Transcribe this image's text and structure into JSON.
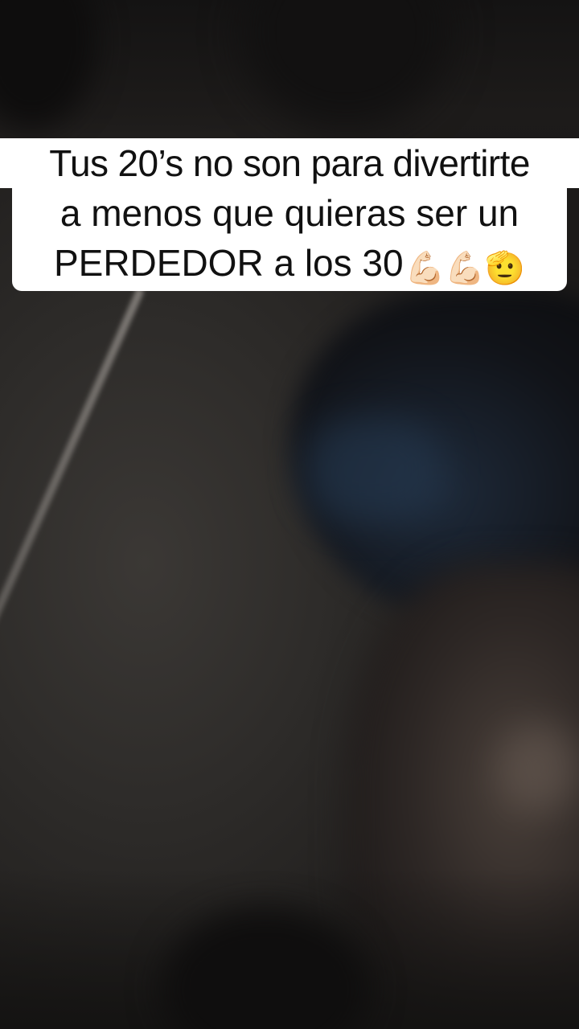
{
  "caption": {
    "line1": "Tus 20’s no son para divertirte",
    "line2": "a menos que quieras ser un",
    "line3": "PERDEDOR a los 30",
    "emojis": [
      "💪🏻",
      "💪🏻",
      "🫡"
    ]
  },
  "colors": {
    "caption_bg": "#ffffff",
    "caption_text": "#111111",
    "background": "#2d2b29"
  }
}
